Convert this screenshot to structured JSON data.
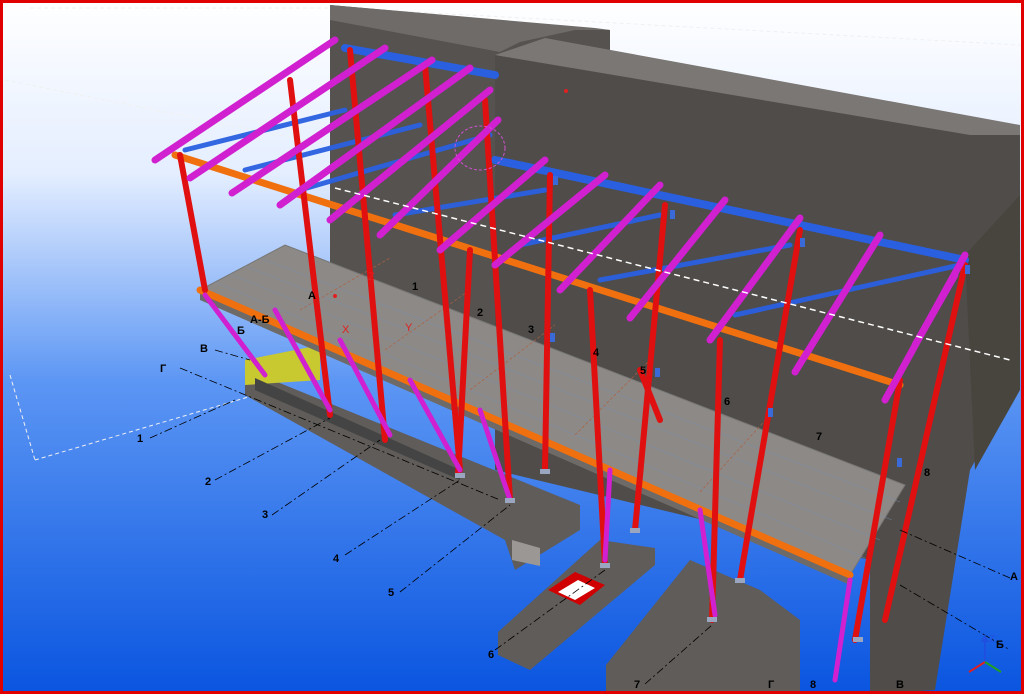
{
  "viewport": {
    "background_top": "#ffffff",
    "background_bottom": "#0a55e0",
    "border_color": "#e00000"
  },
  "colors": {
    "column": "#e01010",
    "brace": "#d020d0",
    "rafter": "#d020d0",
    "purlin": "#2a60e0",
    "ridge_beam": "#2a60e0",
    "edge_beam": "#f07010",
    "floor": "#8c8986",
    "wall": "#55524f",
    "foundation": "#5f5c59"
  },
  "grid_labels": {
    "numbered_axes": [
      "1",
      "2",
      "3",
      "4",
      "5",
      "6",
      "7",
      "8"
    ],
    "lettered_axes": [
      "А",
      "Б",
      "В",
      "Г"
    ],
    "near_side_numbers": [
      "1",
      "2",
      "3",
      "4",
      "5",
      "6",
      "7"
    ],
    "near_side_letters": [
      "Г",
      "В"
    ],
    "left_letters": [
      "Г",
      "В",
      "Б",
      "А-Б",
      "А"
    ],
    "right_letters": [
      "А",
      "Б"
    ],
    "far_side_number": "8",
    "far_side_letters": [
      "Г",
      "В"
    ]
  },
  "axis_triad": {
    "z_label": "Z",
    "icons": [
      "axis-z-icon",
      "axis-x-icon",
      "axis-y-icon"
    ]
  },
  "cursor_markers": {
    "x_label": "X",
    "y_label": "Y",
    "z_label": "Z"
  }
}
